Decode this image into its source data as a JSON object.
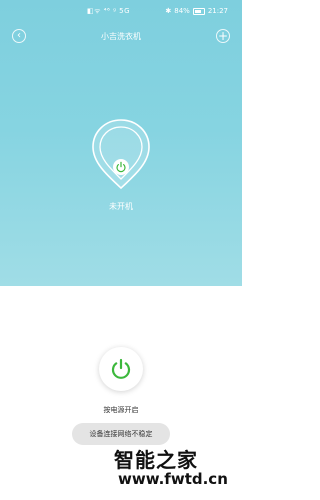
{
  "status_bar": {
    "left_text": "◧ᯤ ⁴⁶ ᵍ 5G",
    "battery": "84%",
    "time": "21:27"
  },
  "nav": {
    "back_icon": "chevron-left-icon",
    "title": "小吉洗衣机",
    "add_icon": "plus-icon"
  },
  "device": {
    "icon": "washer-drop-icon",
    "status": "未开机"
  },
  "power": {
    "icon": "power-icon",
    "hint": "按电源开启"
  },
  "toast": {
    "message": "设备连接网络不稳定"
  },
  "watermark": {
    "title": "智能之家",
    "url": "www.fwtd.cn"
  },
  "colors": {
    "hero_top": "#7ecfde",
    "hero_bottom": "#a0dde6",
    "accent_green": "#3cb83c"
  }
}
